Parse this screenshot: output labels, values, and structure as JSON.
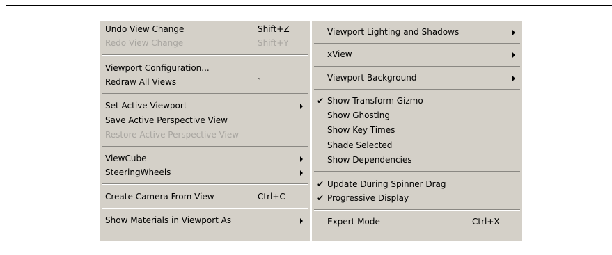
{
  "left_menu": {
    "undo_view_change": {
      "label": "Undo View Change",
      "shortcut": "Shift+Z"
    },
    "redo_view_change": {
      "label": "Redo View Change",
      "shortcut": "Shift+Y"
    },
    "viewport_configuration": {
      "label": "Viewport Configuration..."
    },
    "redraw_all_views": {
      "label": "Redraw All Views",
      "shortcut": "`"
    },
    "set_active_viewport": {
      "label": "Set Active Viewport"
    },
    "save_active_perspective": {
      "label": "Save Active Perspective View"
    },
    "restore_active_perspective": {
      "label": "Restore Active Perspective View"
    },
    "viewcube": {
      "label": "ViewCube"
    },
    "steeringwheels": {
      "label": "SteeringWheels"
    },
    "create_camera": {
      "label": "Create Camera From View",
      "shortcut": "Ctrl+C"
    },
    "show_materials": {
      "label": "Show Materials in Viewport As"
    }
  },
  "right_menu": {
    "viewport_lighting": {
      "label": "Viewport Lighting and Shadows"
    },
    "xview": {
      "label": "xView"
    },
    "viewport_background": {
      "label": "Viewport Background"
    },
    "show_transform_gizmo": {
      "label": "Show Transform Gizmo",
      "checked": true
    },
    "show_ghosting": {
      "label": "Show Ghosting"
    },
    "show_key_times": {
      "label": "Show Key Times"
    },
    "shade_selected": {
      "label": "Shade Selected"
    },
    "show_dependencies": {
      "label": "Show Dependencies"
    },
    "update_during_spinner_drag": {
      "label": "Update During Spinner Drag",
      "checked": true
    },
    "progressive_display": {
      "label": "Progressive Display",
      "checked": true
    },
    "expert_mode": {
      "label": "Expert Mode",
      "shortcut": "Ctrl+X"
    }
  },
  "icons": {
    "check": "✔"
  }
}
